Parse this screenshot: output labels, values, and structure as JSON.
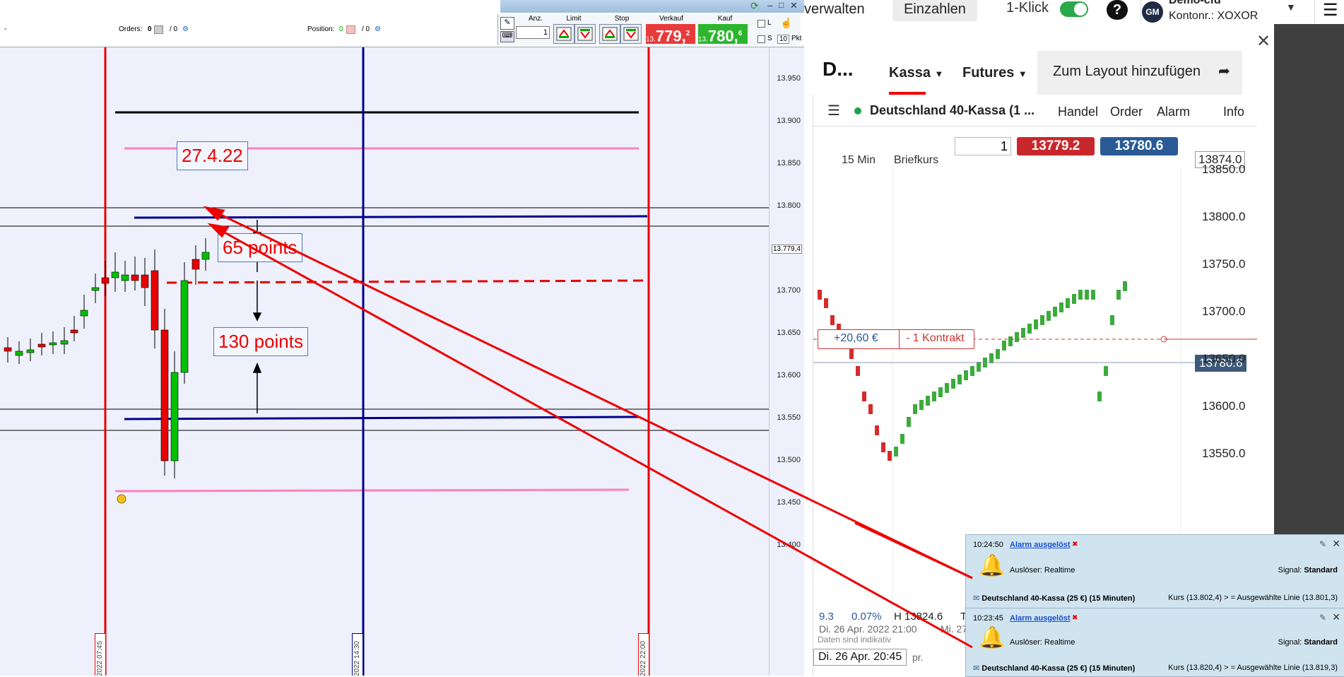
{
  "left_toolbar": {
    "dash": "-",
    "orders_label": "Orders:",
    "orders_value": "0",
    "orders_sep": "/ 0",
    "position_label": "Position:",
    "position_value": "0",
    "position_sep": "/ 0",
    "anz_label": "Anz.",
    "anz_value": "1",
    "limit_label": "Limit",
    "stop_label": "Stop",
    "verkauf_label": "Verkauf",
    "kauf_label": "Kauf",
    "verkauf_prefix": "13.",
    "verkauf_main": "779,",
    "verkauf_sup": "2",
    "kauf_prefix": "13.",
    "kauf_main": "780,",
    "kauf_sup": "6",
    "opt_l": "L",
    "opt_s": "S",
    "pkt_value": "10",
    "pkt_label": "Pkt"
  },
  "left_chart": {
    "y_ticks": [
      "13.950",
      "13.900",
      "13.850",
      "13.800",
      "13.750",
      "13.700",
      "13.650",
      "13.600",
      "13.550",
      "13.500",
      "13.450",
      "13.400"
    ],
    "current_price_label": "13.779,4",
    "annotation_date": "27.4.22",
    "annotation_65": "65 points",
    "annotation_130": "130 points",
    "vline_dates": [
      "2022 07:45",
      "2022 14:30",
      "2022 22:00"
    ],
    "colors": {
      "red": "#e60000",
      "blue": "#00008b",
      "pink": "#ff7fc0",
      "black": "#000000",
      "green": "#00c000"
    }
  },
  "top_nav": {
    "verwalten": "verwalten",
    "einzahlen": "Einzahlen",
    "one_click": "1-Klick",
    "help": "?",
    "account_initials": "GM",
    "account_name": "Demo-cfd",
    "account_number": "Kontonr.: XOXOR"
  },
  "panel": {
    "title": "D...",
    "tabs": [
      "Kassa",
      "Futures"
    ],
    "add_layout": "Zum Layout hinzufügen",
    "instrument": "Deutschland 40-Kassa (1 ...",
    "menu": [
      "Handel",
      "Order",
      "Alarm",
      "Info"
    ],
    "qty": "1",
    "sell": "13779.2",
    "buy": "13780.6",
    "interval": "15 Min",
    "price_type": "Briefkurs",
    "right_ticks": [
      "13850.0",
      "13800.0",
      "13750.0",
      "13700.0",
      "13650.0",
      "13600.0",
      "13550.0"
    ],
    "top_price_tag": "13874.0",
    "current_tag": "13780.6",
    "position_pnl": "+20,60 €",
    "position_size": "- 1 Kontrakt",
    "stats_1": "9.3",
    "stats_2": "0.07%",
    "stats_3": "H 13824.6",
    "stats_4": "T",
    "date_line": "Di. 26 Apr. 2022 21:00",
    "date_line2": "Mi. 27",
    "indicative": "Daten sind indikativ",
    "hover_date": "Di. 26 Apr. 20:45",
    "hover_date2": "pr."
  },
  "alarms": [
    {
      "time": "10:24:50",
      "title": "Alarm ausgelöst",
      "trigger": "Auslöser: Realtime",
      "signal_label": "Signal:",
      "signal_value": "Standard",
      "instrument": "Deutschland 40-Kassa (25 €) (15 Minuten)",
      "condition": "Kurs (13.802,4)  > =  Ausgewählte Linie (13.801,3)"
    },
    {
      "time": "10:23:45",
      "title": "Alarm ausgelöst",
      "trigger": "Auslöser: Realtime",
      "signal_label": "Signal:",
      "signal_value": "Standard",
      "instrument": "Deutschland 40-Kassa (25 €) (15 Minuten)",
      "condition": "Kurs (13.820,4)  > =  Ausgewählte Linie (13.819,3)"
    }
  ]
}
